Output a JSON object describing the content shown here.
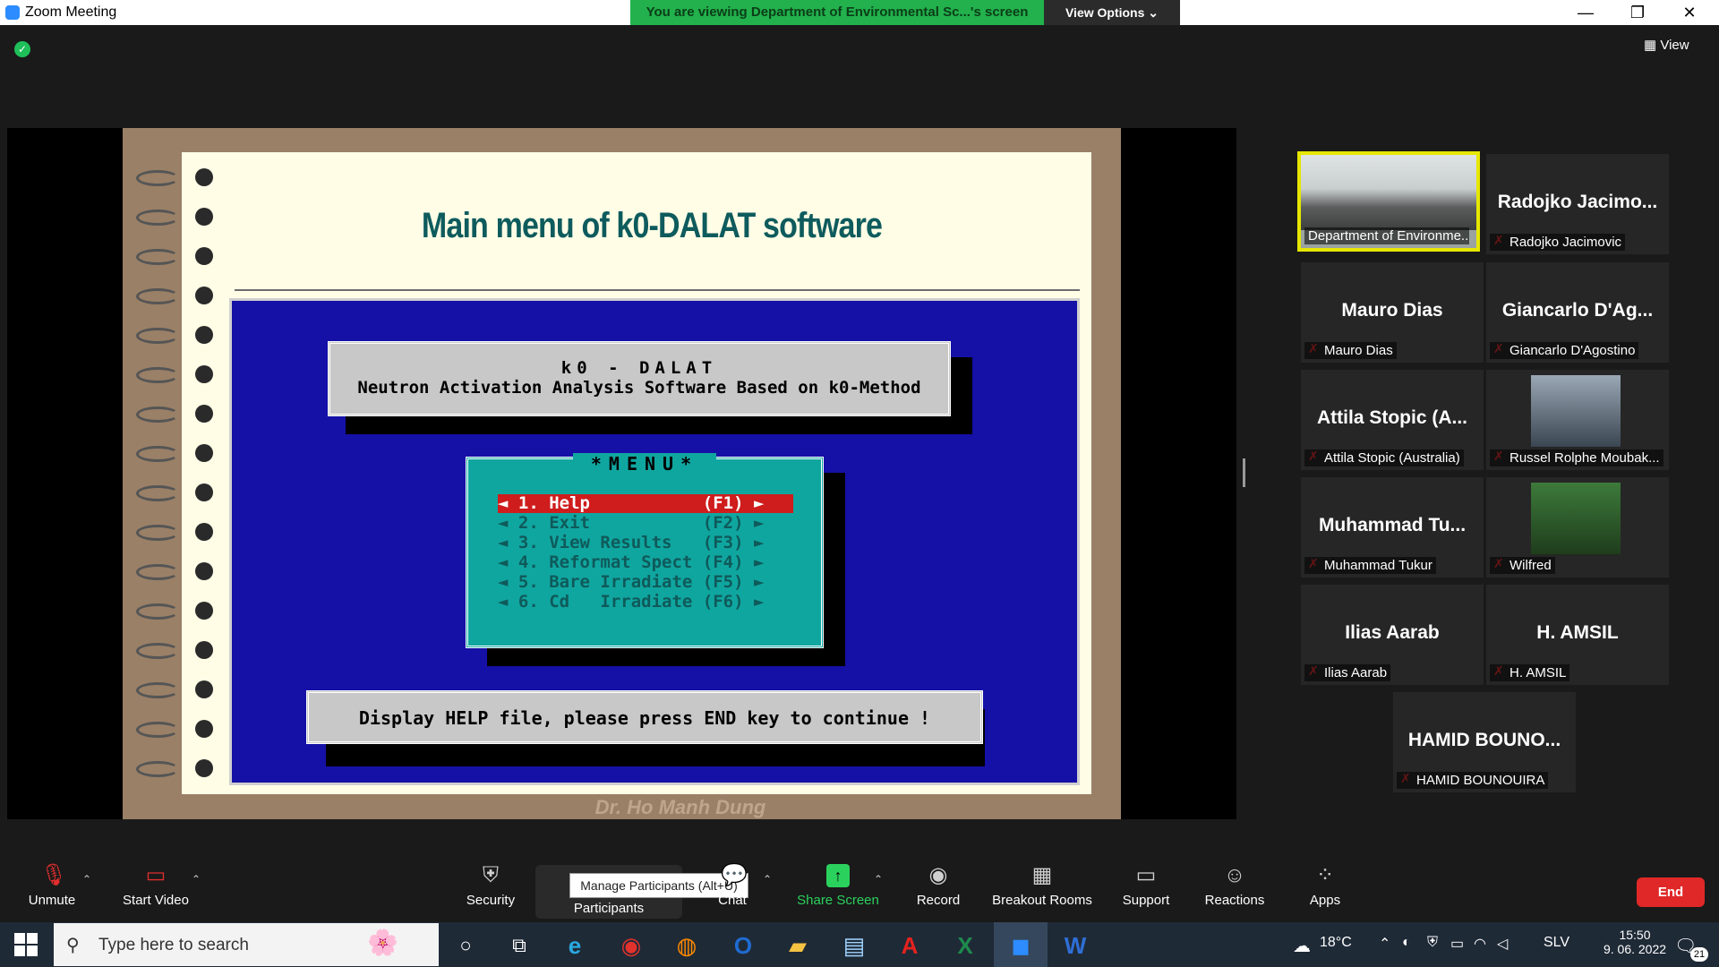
{
  "window": {
    "title": "Zoom Meeting",
    "viewing_banner": "You are viewing Department of Environmental Sc...'s screen",
    "view_options": "View Options ⌄",
    "minimize": "—",
    "restore": "❐",
    "close": "✕"
  },
  "topbar": {
    "view_label": "View"
  },
  "slide": {
    "title": "Main menu of k0-DALAT software",
    "header_line1": "k0 - DALAT",
    "header_line2": "Neutron Activation Analysis Software Based on k0-Method",
    "menu_title": "*MENU*",
    "menu_items": [
      "◄ 1. Help           (F1) ►",
      "◄ 2. Exit           (F2) ►",
      "◄ 3. View Results   (F3) ►",
      "◄ 4. Reformat Spect (F4) ►",
      "◄ 5. Bare Irradiate (F5) ►",
      "◄ 6. Cd   Irradiate (F6) ►"
    ],
    "status_text": "Display HELP file, please press END key to continue !",
    "watermark": "Dr. Ho Manh Dung"
  },
  "participants": [
    {
      "name": "",
      "label": "Department of Environme..."
    },
    {
      "name": "Radojko Jacimo...",
      "label": "Radojko Jacimovic"
    },
    {
      "name": "Mauro Dias",
      "label": "Mauro Dias"
    },
    {
      "name": "Giancarlo D'Ag...",
      "label": "Giancarlo D'Agostino"
    },
    {
      "name": "Attila Stopic (A...",
      "label": "Attila Stopic (Australia)"
    },
    {
      "name": "",
      "label": "Russel Rolphe Moubak..."
    },
    {
      "name": "Muhammad Tu...",
      "label": "Muhammad Tukur"
    },
    {
      "name": "",
      "label": "Wilfred"
    },
    {
      "name": "Ilias Aarab",
      "label": "Ilias Aarab"
    },
    {
      "name": "H. AMSIL",
      "label": "H. AMSIL"
    },
    {
      "name": "HAMID BOUNO...",
      "label": "HAMID BOUNOUIRA"
    }
  ],
  "toolbar": {
    "unmute": "Unmute",
    "start_video": "Start Video",
    "security": "Security",
    "participants": "Participants",
    "participants_tooltip": "Manage Participants (Alt+U)",
    "chat": "Chat",
    "share_screen": "Share Screen",
    "record": "Record",
    "breakout": "Breakout Rooms",
    "support": "Support",
    "reactions": "Reactions",
    "apps": "Apps",
    "end": "End"
  },
  "taskbar": {
    "search_placeholder": "Type here to search",
    "temperature": "18°C",
    "language": "SLV",
    "time": "15:50",
    "date": "9. 06. 2022",
    "notifications": "21"
  },
  "colors": {
    "zoom_blue": "#2d8cff",
    "banner_green": "#22b14c",
    "end_red": "#e02828",
    "dos_blue": "#1510a6",
    "menu_teal": "#10a6a0"
  }
}
